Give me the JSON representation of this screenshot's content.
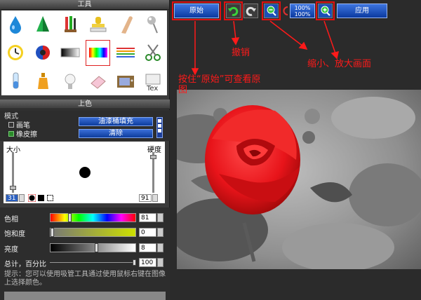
{
  "tools_panel": {
    "title": "工具",
    "tools": [
      "water-drop-icon",
      "cone-icon",
      "paint-brushes-icon",
      "stamp-icon",
      "smudge-finger-icon",
      "pin-icon",
      "clock-icon",
      "color-circle-icon",
      "gradient-icon",
      "hue-gradient-icon",
      "lines-icon",
      "scissors-icon",
      "test-tube-icon",
      "bottle-icon",
      "bulb-icon",
      "eraser-icon",
      "tv-icon",
      "text-icon"
    ],
    "selected_index": 9
  },
  "coloring_panel": {
    "title": "上色",
    "mode_label": "模式",
    "options": [
      {
        "label": "画笔",
        "checked": false
      },
      {
        "label": "橡皮擦",
        "checked": true
      }
    ],
    "fill_button": "油漆桶填充",
    "clear_button": "清除"
  },
  "brush": {
    "size_label": "大小",
    "hardness_label": "硬度",
    "size_value": "31",
    "hardness_value": "91"
  },
  "adjustments": [
    {
      "label": "色相",
      "value": "81",
      "level": 0.21
    },
    {
      "label": "饱和度",
      "value": "0",
      "level": 0.0
    },
    {
      "label": "亮度",
      "value": "8",
      "level": 0.53
    },
    {
      "label": "总计，百分比",
      "value": "100",
      "level": 1.0
    }
  ],
  "hint": "提示：您可以使用吸管工具通过使用鼠标右键在图像上选择颜色。",
  "toolbar": {
    "original_button": "原始",
    "apply_button": "应用",
    "zoom_top": "100%",
    "zoom_bottom": "100%"
  },
  "annotations": {
    "hold_original": "按住“原始”可查看原图",
    "undo": "撤销",
    "zoom": "缩小、放大画面"
  },
  "colors": {
    "accent_blue": "#0b3aa0",
    "annotation_red": "#ff1a1a",
    "rose_red": "#e8141a"
  }
}
